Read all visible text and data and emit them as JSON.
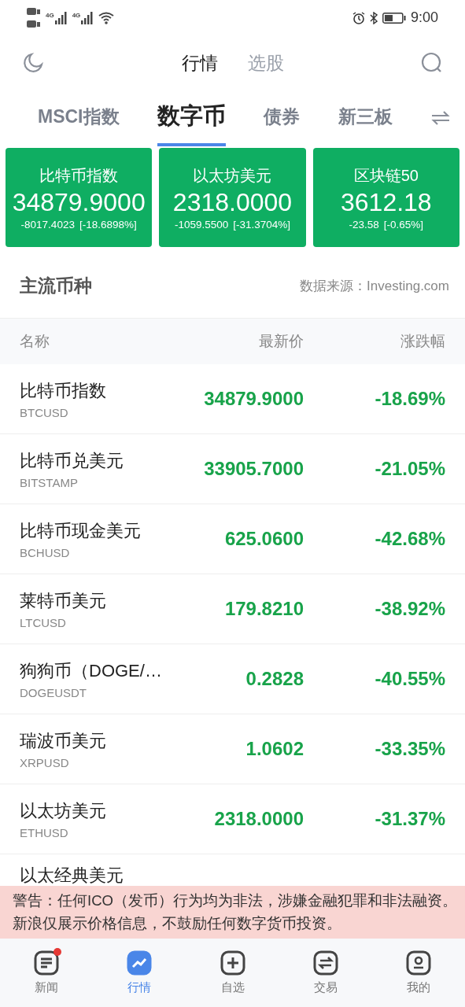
{
  "status_bar": {
    "networks": [
      "4G",
      "4G"
    ],
    "time": "9:00"
  },
  "header_tabs": [
    {
      "label": "行情",
      "selected": true
    },
    {
      "label": "选股",
      "selected": false
    }
  ],
  "category_tabs": [
    {
      "label": "MSCI指数",
      "selected": false
    },
    {
      "label": "数字币",
      "selected": true
    },
    {
      "label": "债券",
      "selected": false
    },
    {
      "label": "新三板",
      "selected": false
    }
  ],
  "index_cards": [
    {
      "name": "比特币指数",
      "price": "34879.9000",
      "change": "-8017.4023",
      "percent": "[-18.6898%]"
    },
    {
      "name": "以太坊美元",
      "price": "2318.0000",
      "change": "-1059.5500",
      "percent": "[-31.3704%]"
    },
    {
      "name": "区块链50",
      "price": "3612.18",
      "change": "-23.58",
      "percent": "[-0.65%]"
    }
  ],
  "section": {
    "title": "主流币种",
    "source": "数据来源：Investing.com"
  },
  "table": {
    "columns": [
      "名称",
      "最新价",
      "涨跌幅"
    ],
    "rows": [
      {
        "name": "比特币指数",
        "code": "BTCUSD",
        "price": "34879.9000",
        "change": "-18.69%"
      },
      {
        "name": "比特币兑美元",
        "code": "BITSTAMP",
        "price": "33905.7000",
        "change": "-21.05%"
      },
      {
        "name": "比特币现金美元",
        "code": "BCHUSD",
        "price": "625.0600",
        "change": "-42.68%"
      },
      {
        "name": "莱特币美元",
        "code": "LTCUSD",
        "price": "179.8210",
        "change": "-38.92%"
      },
      {
        "name": "狗狗币（DOGE/…",
        "code": "DOGEUSDT",
        "price": "0.2828",
        "change": "-40.55%"
      },
      {
        "name": "瑞波币美元",
        "code": "XRPUSD",
        "price": "1.0602",
        "change": "-33.35%"
      },
      {
        "name": "以太坊美元",
        "code": "ETHUSD",
        "price": "2318.0000",
        "change": "-31.37%"
      },
      {
        "name": "以太经典美元"
      }
    ]
  },
  "warning": "警告：任何ICO（发币）行为均为非法，涉嫌金融犯罪和非法融资。新浪仅展示价格信息，不鼓励任何数字货币投资。",
  "bottom_nav": [
    {
      "kind": "news",
      "label": "新闻",
      "selected": false,
      "badge": true
    },
    {
      "kind": "market",
      "label": "行情",
      "selected": true,
      "badge": false
    },
    {
      "kind": "watchlist",
      "label": "自选",
      "selected": false,
      "badge": false
    },
    {
      "kind": "trade",
      "label": "交易",
      "selected": false,
      "badge": false
    },
    {
      "kind": "profile",
      "label": "我的",
      "selected": false,
      "badge": false
    }
  ]
}
